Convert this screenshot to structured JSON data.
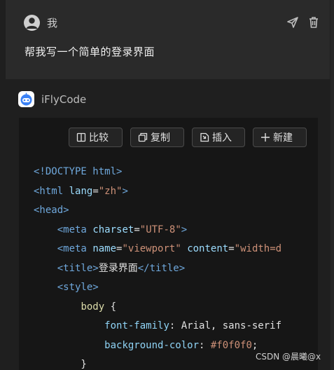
{
  "user": {
    "name": "我",
    "message": "帮我写一个简单的登录界面"
  },
  "assistant": {
    "name": "iFlyCode"
  },
  "toolbar": {
    "compare": "比较",
    "copy": "复制",
    "insert": "插入",
    "new": "新建"
  },
  "code": [
    [
      [
        "tag",
        "<!DOCTYPE html>"
      ]
    ],
    [
      [
        "tag",
        "<html"
      ],
      [
        "txt",
        " "
      ],
      [
        "attr",
        "lang"
      ],
      [
        "txt",
        "="
      ],
      [
        "str",
        "\"zh\""
      ],
      [
        "tag",
        ">"
      ]
    ],
    [
      [
        "tag",
        "<head>"
      ]
    ],
    [
      [
        "txt",
        "    "
      ],
      [
        "tag",
        "<meta"
      ],
      [
        "txt",
        " "
      ],
      [
        "attr",
        "charset"
      ],
      [
        "txt",
        "="
      ],
      [
        "str",
        "\"UTF-8\""
      ],
      [
        "tag",
        ">"
      ]
    ],
    [
      [
        "txt",
        "    "
      ],
      [
        "tag",
        "<meta"
      ],
      [
        "txt",
        " "
      ],
      [
        "attr",
        "name"
      ],
      [
        "txt",
        "="
      ],
      [
        "str",
        "\"viewport\""
      ],
      [
        "txt",
        " "
      ],
      [
        "attr",
        "content"
      ],
      [
        "txt",
        "="
      ],
      [
        "str",
        "\"width=d"
      ]
    ],
    [
      [
        "txt",
        "    "
      ],
      [
        "tag",
        "<title>"
      ],
      [
        "txt",
        "登录界面"
      ],
      [
        "tag",
        "</title>"
      ]
    ],
    [
      [
        "txt",
        "    "
      ],
      [
        "tag",
        "<style>"
      ]
    ],
    [
      [
        "txt",
        "        "
      ],
      [
        "sel",
        "body"
      ],
      [
        "txt",
        " {"
      ]
    ],
    [
      [
        "txt",
        "            "
      ],
      [
        "prop",
        "font-family"
      ],
      [
        "txt",
        ": Arial, sans-serif"
      ]
    ],
    [
      [
        "txt",
        "            "
      ],
      [
        "prop",
        "background-color"
      ],
      [
        "txt",
        ": "
      ],
      [
        "str",
        "#f0f0f0"
      ],
      [
        "txt",
        ";"
      ]
    ],
    [
      [
        "txt",
        "        }"
      ]
    ]
  ],
  "watermark": "CSDN @晨曦@x",
  "colors": {
    "background": "#1f1f1f",
    "user_block": "#2a2a2a",
    "code_bg": "#161616",
    "accent": "#3b82f6"
  }
}
